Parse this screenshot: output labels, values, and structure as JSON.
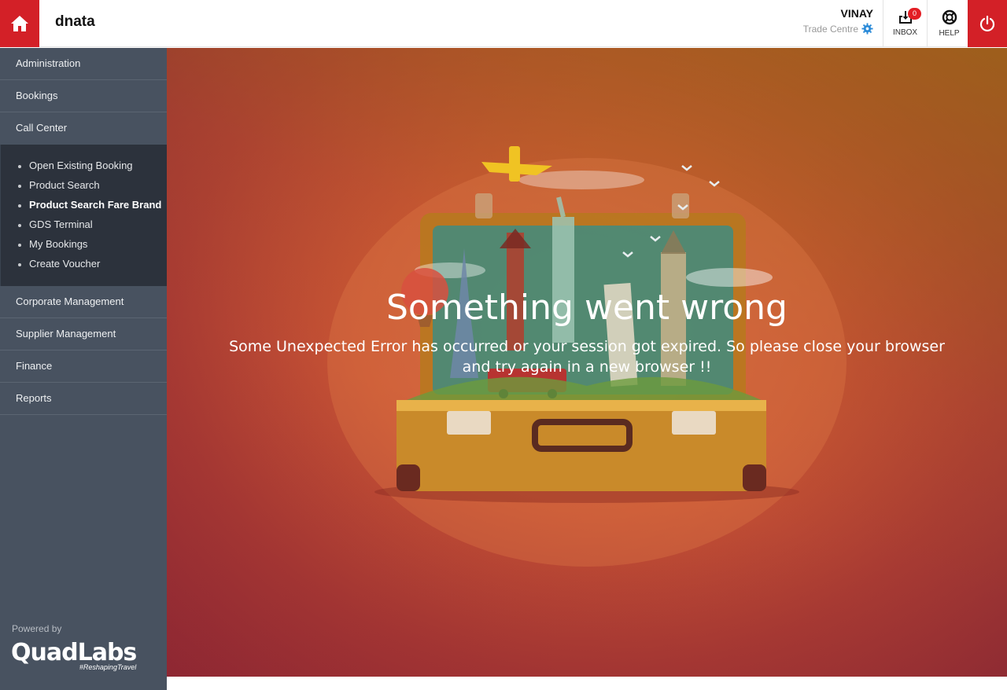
{
  "header": {
    "brand": "dnata",
    "user_name": "VINAY",
    "user_role": "Trade Centre",
    "inbox_label": "INBOX",
    "inbox_count": "0",
    "help_label": "HELP"
  },
  "sidebar": {
    "items_top": [
      {
        "label": "Administration"
      },
      {
        "label": "Bookings"
      },
      {
        "label": "Call Center"
      }
    ],
    "submenu": [
      {
        "label": "Open Existing Booking"
      },
      {
        "label": "Product Search"
      },
      {
        "label": "Product Search Fare Brand"
      },
      {
        "label": "GDS Terminal"
      },
      {
        "label": "My Bookings"
      },
      {
        "label": "Create Voucher"
      }
    ],
    "items_bottom": [
      {
        "label": "Corporate Management"
      },
      {
        "label": "Supplier Management"
      },
      {
        "label": "Finance"
      },
      {
        "label": "Reports"
      }
    ],
    "powered_by": "Powered by",
    "logo_text": "QuadLabs",
    "logo_tagline": "#ReshapingTravel"
  },
  "error": {
    "title": "Something went wrong",
    "message": "Some Unexpected Error has occurred or your session got expired. So please close your browser and try again in a new browser !!"
  },
  "icons": {
    "home": "home-icon",
    "settings": "gear-icon",
    "inbox": "inbox-icon",
    "help": "lifebuoy-icon",
    "power": "power-icon"
  },
  "colors": {
    "accent_red": "#d32027",
    "sidebar_bg": "#485260",
    "submenu_bg": "#2c323c",
    "gear_blue": "#2a8ad8"
  }
}
